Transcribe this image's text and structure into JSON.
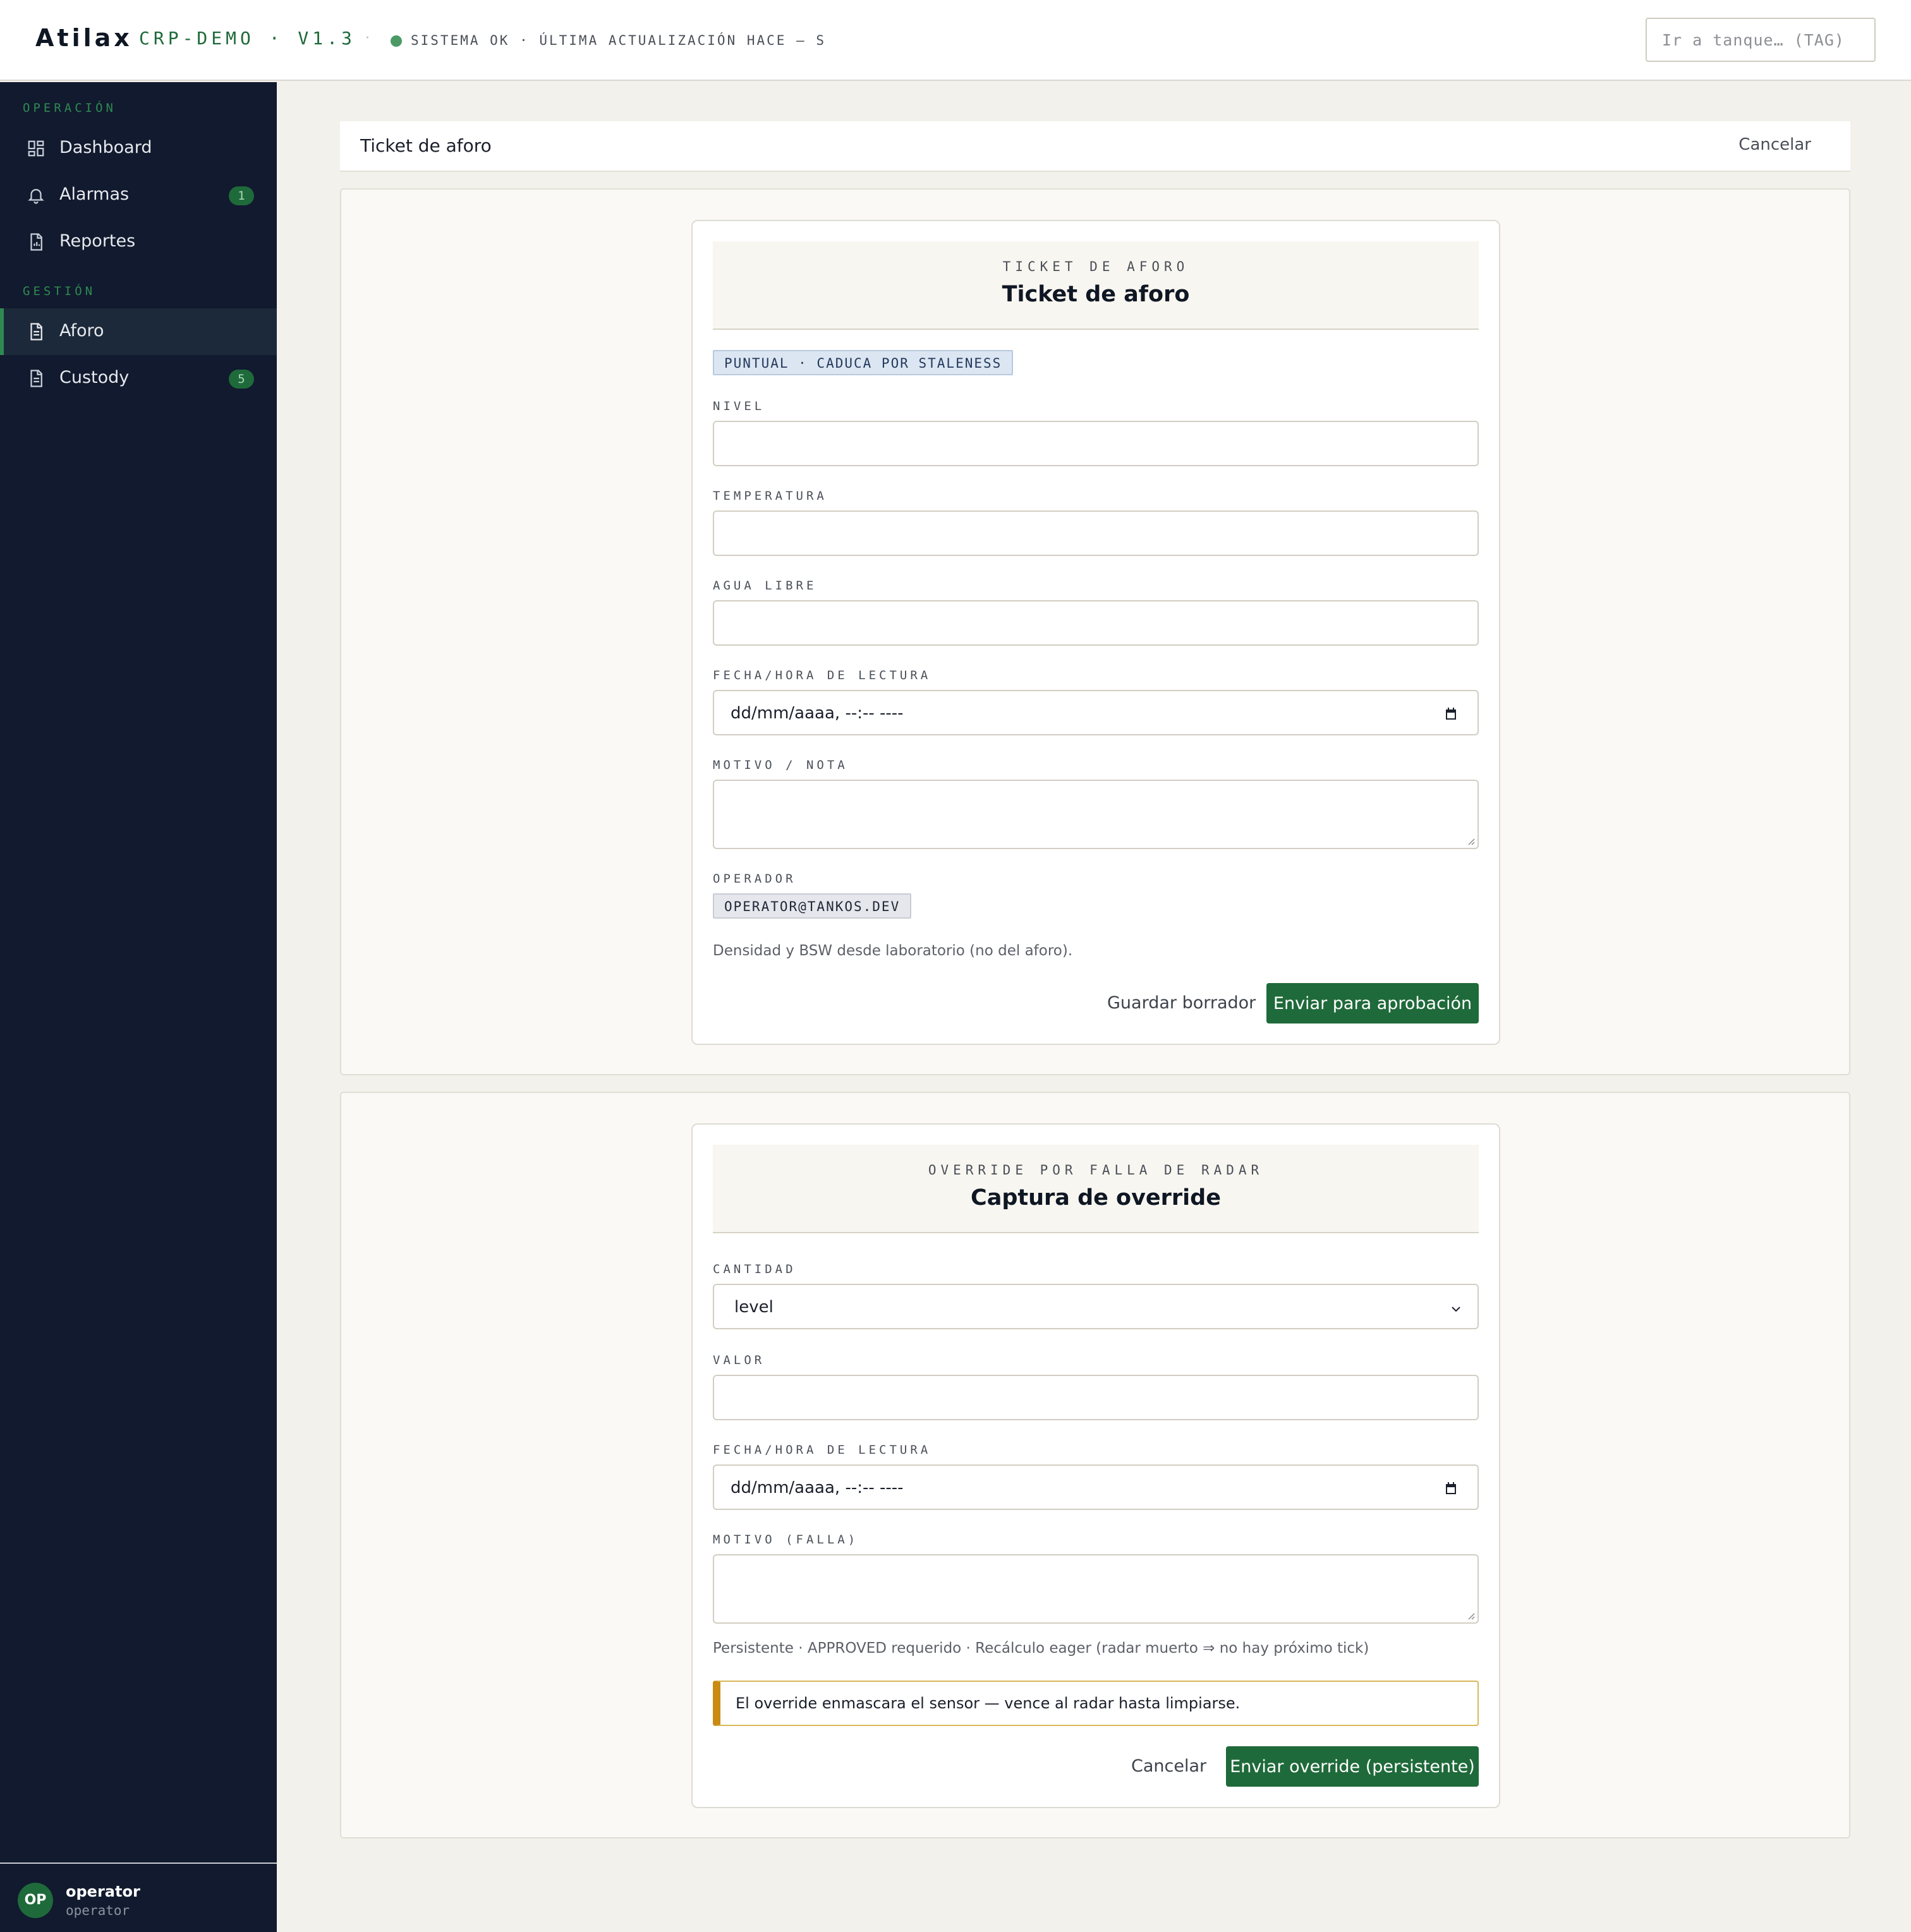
{
  "topbar": {
    "brand": "Atilax",
    "env": "CRP-DEMO · V1.3",
    "separator": "·",
    "status": "SISTEMA OK · ÚLTIMA ACTUALIZACIÓN HACE — S",
    "search_placeholder": "Ir a tanque… (TAG)"
  },
  "sidebar": {
    "sections": [
      {
        "title": "OPERACIÓN",
        "items": [
          {
            "label": "Dashboard",
            "icon": "grid-icon"
          },
          {
            "label": "Alarmas",
            "icon": "bell-icon",
            "badge": "1"
          },
          {
            "label": "Reportes",
            "icon": "report-icon"
          }
        ]
      },
      {
        "title": "GESTIÓN",
        "items": [
          {
            "label": "Aforo",
            "icon": "document-icon",
            "active": true
          },
          {
            "label": "Custody",
            "icon": "document-icon",
            "badge": "5"
          }
        ]
      }
    ],
    "user": {
      "initials": "OP",
      "name": "operator",
      "role": "operator"
    }
  },
  "header": {
    "title": "Ticket de aforo",
    "cancel": "Cancelar"
  },
  "ticket": {
    "eyebrow": "TICKET DE AFORO",
    "title": "Ticket de aforo",
    "tag": "PUNTUAL · CADUCA POR STALENESS",
    "fields": {
      "nivel": "NIVEL",
      "temperatura": "TEMPERATURA",
      "agua": "AGUA LIBRE",
      "fecha": "FECHA/HORA DE LECTURA",
      "fecha_value": "dd/mm/aaaa, --:-- ----",
      "motivo": "MOTIVO / NOTA",
      "operador": "OPERADOR",
      "operador_value": "OPERATOR@TANKOS.DEV"
    },
    "hint": "Densidad y BSW desde laboratorio (no del aforo).",
    "save": "Guardar borrador",
    "submit": "Enviar para aprobación"
  },
  "override": {
    "eyebrow": "OVERRIDE POR FALLA DE RADAR",
    "title": "Captura de override",
    "fields": {
      "cantidad": "CANTIDAD",
      "cantidad_value": "level",
      "valor": "VALOR",
      "fecha": "FECHA/HORA DE LECTURA",
      "fecha_value": "dd/mm/aaaa, --:-- ----",
      "motivo": "MOTIVO (FALLA)"
    },
    "hint": "Persistente · APPROVED requerido · Recálculo eager (radar muerto ⇒ no hay próximo tick)",
    "warning": "El override enmascara el sensor — vence al radar hasta limpiarse.",
    "cancel": "Cancelar",
    "submit": "Enviar override (persistente)"
  },
  "colors": {
    "accent": "#1f6a3a",
    "sidebar": "#111a2e",
    "warning": "#c98b12"
  }
}
